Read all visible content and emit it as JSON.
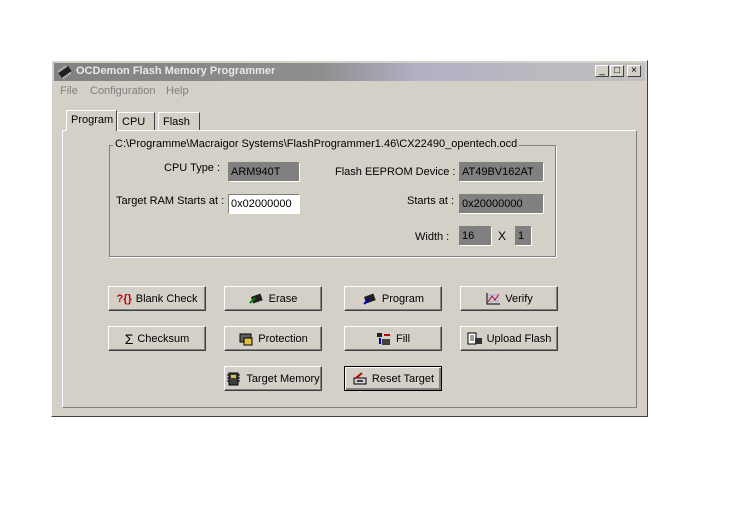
{
  "window": {
    "title": "OCDemon Flash Memory Programmer",
    "minimize": "_",
    "maximize": "□",
    "close": "×"
  },
  "menu": [
    "File",
    "Configuration",
    "Help"
  ],
  "tabs": [
    "Program",
    "CPU",
    "Flash"
  ],
  "config_path": "C:\\Programme\\Macraigor Systems\\FlashProgrammer1.46\\CX22490_opentech.ocd",
  "fields": {
    "cpu_type_label": "CPU Type :",
    "cpu_type_value": "ARM940T",
    "target_ram_label": "Target RAM Starts at :",
    "target_ram_value": "0x02000000",
    "flash_device_label": "Flash EEPROM Device :",
    "flash_device_value": "AT49BV162AT",
    "starts_at_label": "Starts at :",
    "starts_at_value": "0x20000000",
    "width_label": "Width :",
    "width_value": "16",
    "times": "X",
    "count_value": "1"
  },
  "buttons": {
    "blank_check": "Blank Check",
    "erase": "Erase",
    "program": "Program",
    "verify": "Verify",
    "checksum": "Checksum",
    "protection": "Protection",
    "fill": "Fill",
    "upload_flash": "Upload Flash",
    "target_memory": "Target Memory",
    "reset_target": "Reset Target"
  },
  "icons": {
    "blank_check": "?{}",
    "checksum": "Σ"
  }
}
